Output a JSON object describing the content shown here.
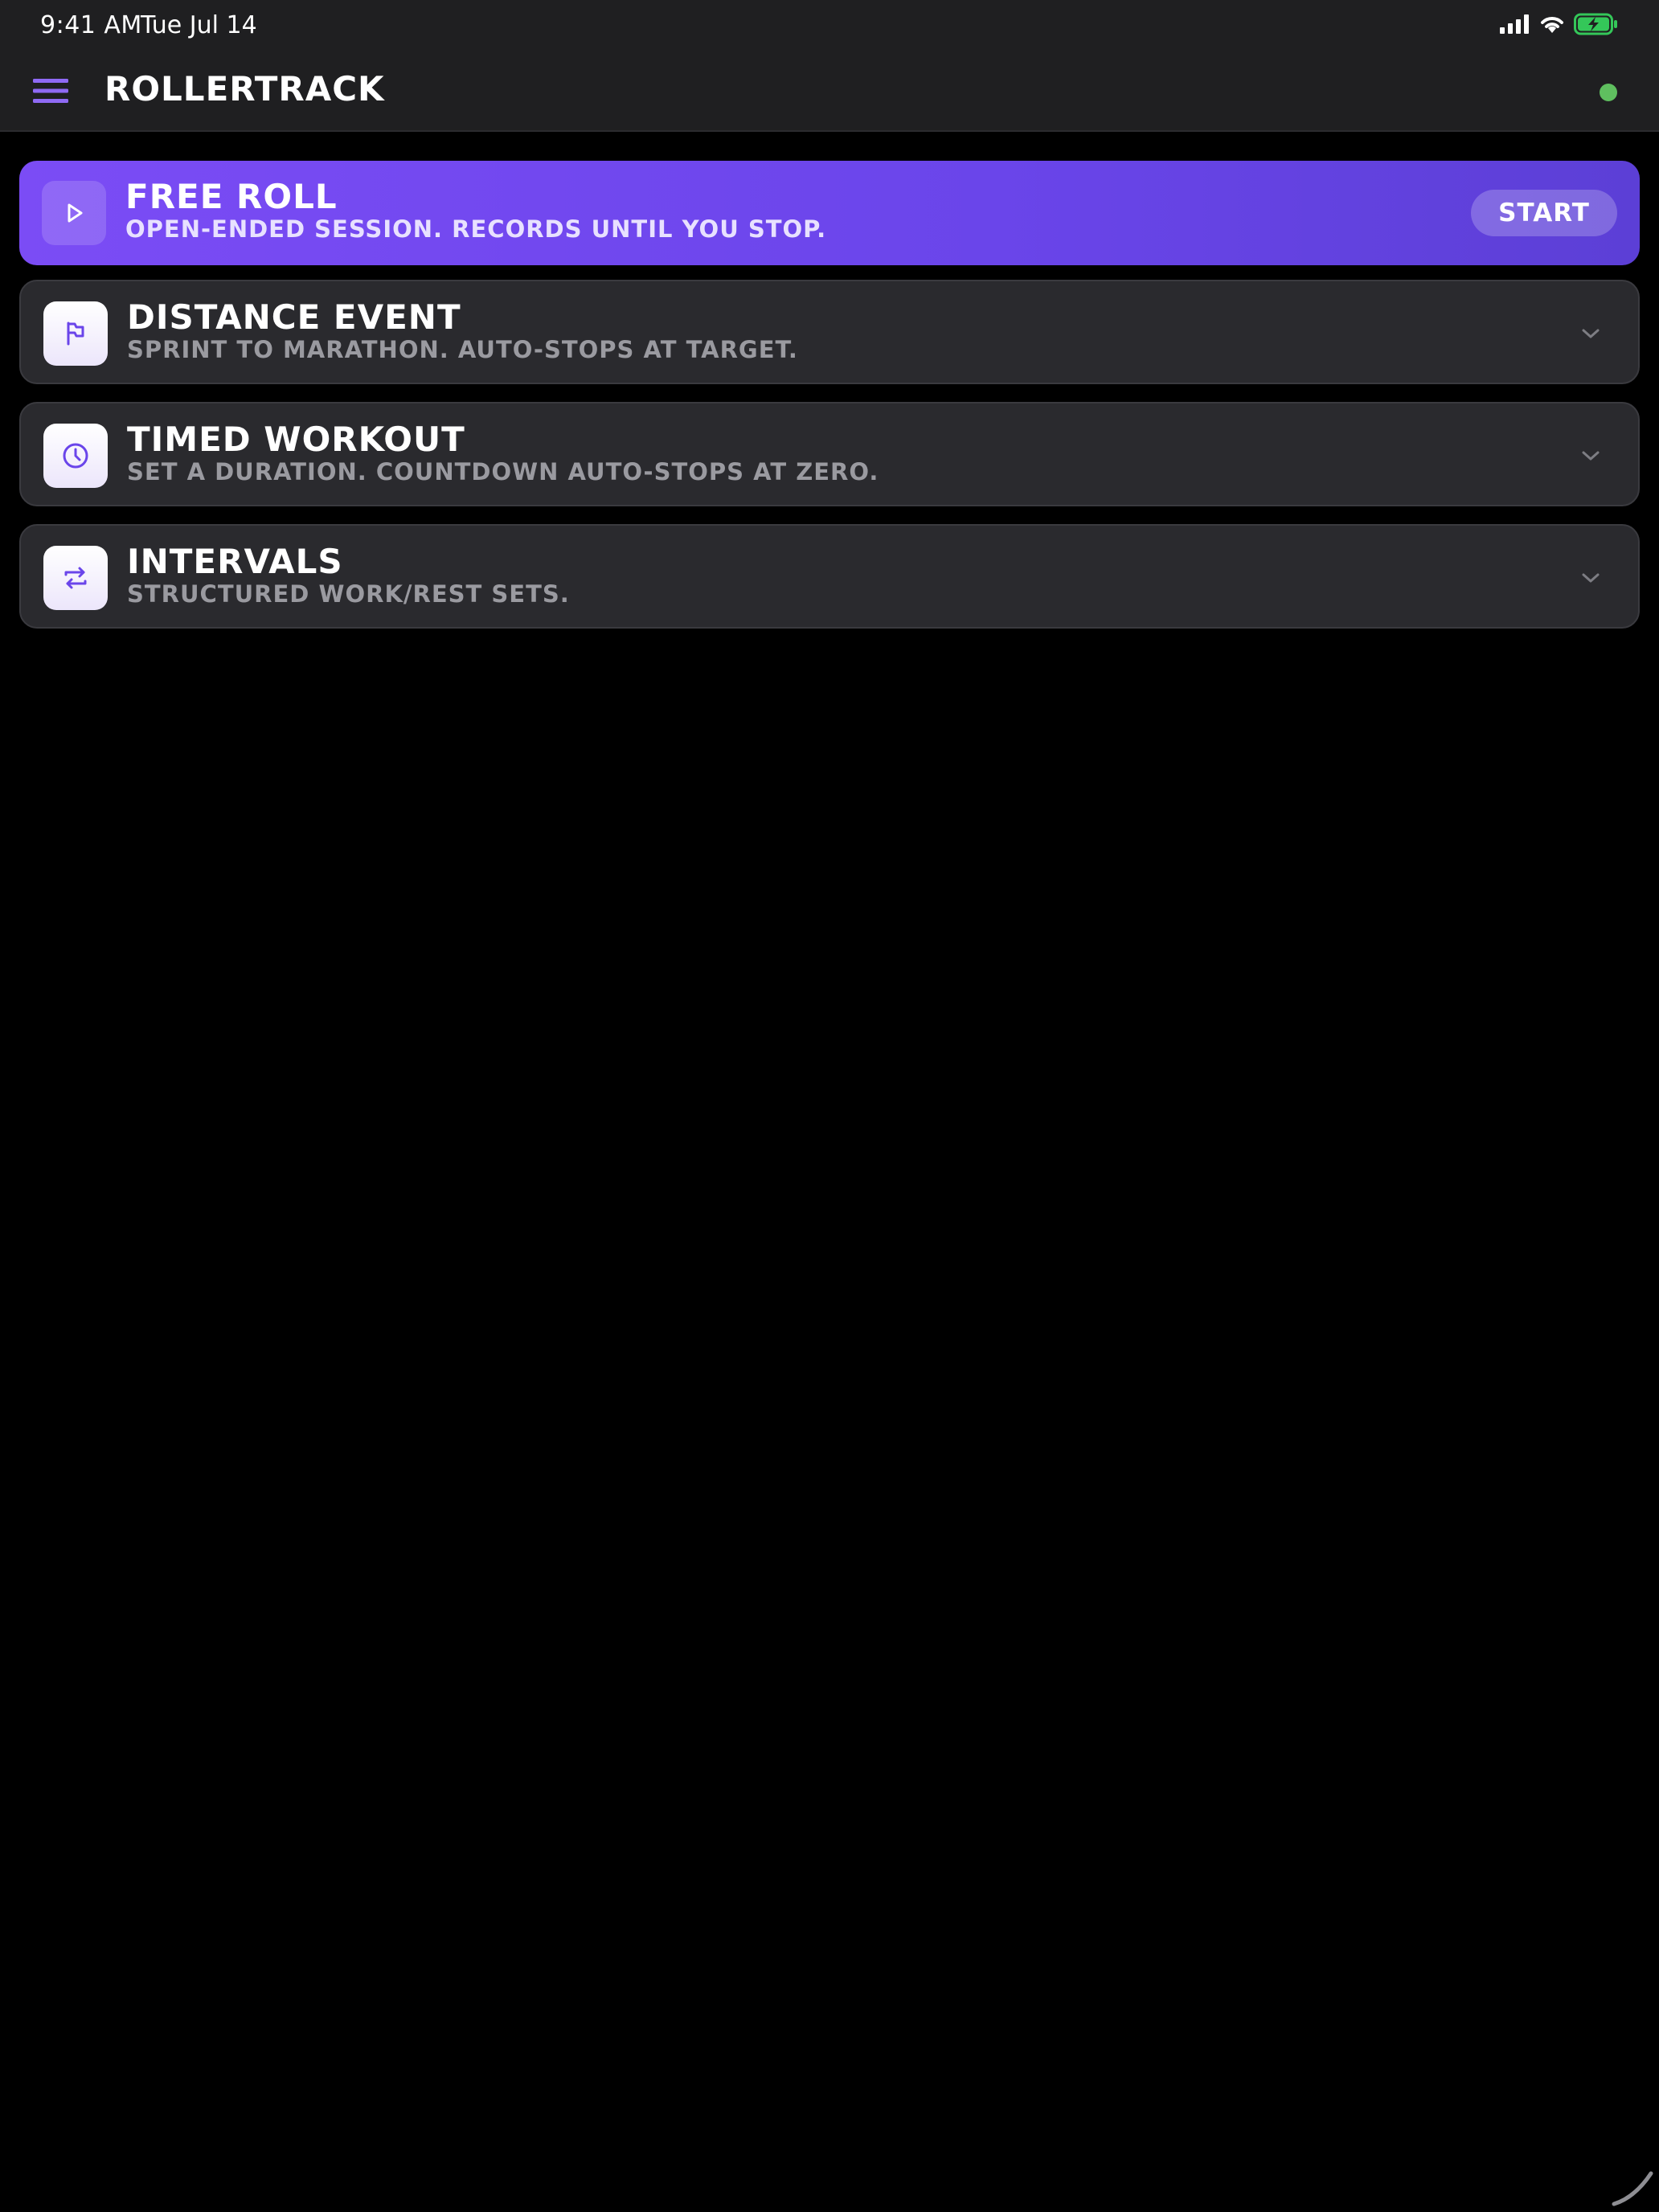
{
  "status_bar": {
    "time": "9:41 AM",
    "date": "Tue Jul 14",
    "battery_color": "#34c759"
  },
  "header": {
    "title": "ROLLERTRACK",
    "menu_icon": "hamburger-icon",
    "connection_status_color": "#5fbf5f"
  },
  "modes": {
    "free_roll": {
      "title": "FREE ROLL",
      "subtitle": "OPEN-ENDED SESSION. RECORDS UNTIL YOU STOP.",
      "action_label": "START",
      "icon": "play-icon"
    },
    "distance_event": {
      "title": "DISTANCE EVENT",
      "subtitle": "SPRINT TO MARATHON. AUTO-STOPS AT TARGET.",
      "icon": "flag-icon"
    },
    "timed_workout": {
      "title": "TIMED WORKOUT",
      "subtitle": "SET A DURATION. COUNTDOWN AUTO-STOPS AT ZERO.",
      "icon": "clock-icon"
    },
    "intervals": {
      "title": "INTERVALS",
      "subtitle": "STRUCTURED WORK/REST SETS.",
      "icon": "repeat-icon"
    }
  },
  "colors": {
    "accent": "#7b4cf5",
    "background": "#000000",
    "card": "#2a2a2e"
  }
}
